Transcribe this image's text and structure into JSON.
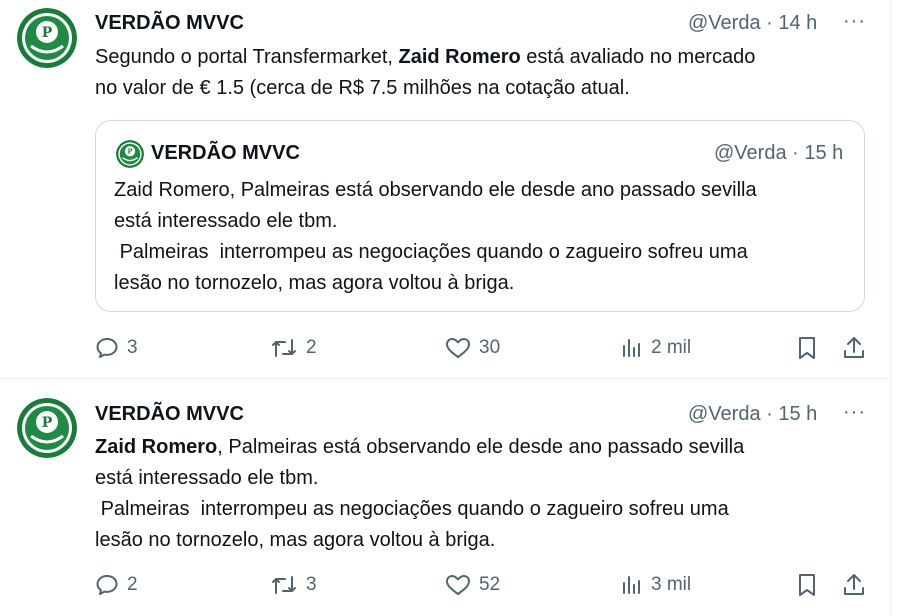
{
  "tweets": [
    {
      "author": "VERDÃO MVVC",
      "handle": "@Verda",
      "time": "· 14 h",
      "more": "···",
      "text_parts": [
        "Segundo o portal Transfermarket, ",
        "Zaid Romero",
        " está avaliado no mercado\nno valor de € 1.5 (cerca de R$ 7.5 milhões na cotação atual."
      ],
      "quote": {
        "author": "VERDÃO MVVC",
        "handle": "@Verda",
        "time": "· 15 h",
        "text": "Zaid Romero, Palmeiras está observando ele desde ano passado sevilla\nestá interessado ele tbm.\n Palmeiras  interrompeu as negociações quando o zagueiro sofreu uma\nlesão no tornozelo, mas agora voltou à briga."
      },
      "replies": "3",
      "retweets": "2",
      "likes": "30",
      "views": "2 mil"
    },
    {
      "author": "VERDÃO MVVC",
      "handle": "@Verda",
      "time": "· 15 h",
      "more": "···",
      "text_parts": [
        "",
        "Zaid Romero",
        ", Palmeiras está observando ele desde ano passado sevilla\nestá interessado ele tbm.\n Palmeiras  interrompeu as negociações quando o zagueiro sofreu uma\nlesão no tornozelo, mas agora voltou à briga."
      ],
      "replies": "2",
      "retweets": "3",
      "likes": "52",
      "views": "3 mil"
    }
  ],
  "icons": {
    "reply": "reply-icon",
    "retweet": "retweet-icon",
    "like": "heart-icon",
    "views": "views-icon",
    "bookmark": "bookmark-icon",
    "share": "share-icon",
    "avatar_logo": "palmeiras-crest-icon"
  },
  "colors": {
    "text": "#0f1419",
    "secondary": "#536471",
    "border": "#cfd9de",
    "crest_green": "#1a7a3a"
  }
}
